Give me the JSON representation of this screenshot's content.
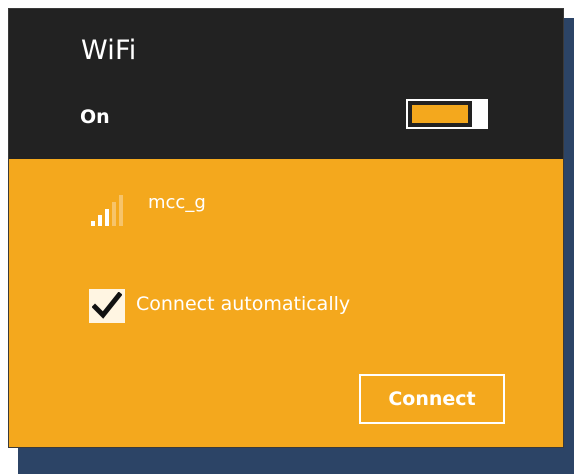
{
  "flyout": {
    "title": "WiFi",
    "toggle": {
      "label": "On",
      "state": "on"
    }
  },
  "network": {
    "name": "mcc_g",
    "signal_icon": "wifi-signal-icon",
    "signal_bars_active": 3,
    "signal_bars_total": 5
  },
  "options": {
    "connect_automatically": {
      "label": "Connect automatically",
      "checked": true
    }
  },
  "actions": {
    "connect_label": "Connect"
  },
  "colors": {
    "accent": "#f4a81d",
    "header_bg": "#222222",
    "text": "#ffffff"
  }
}
